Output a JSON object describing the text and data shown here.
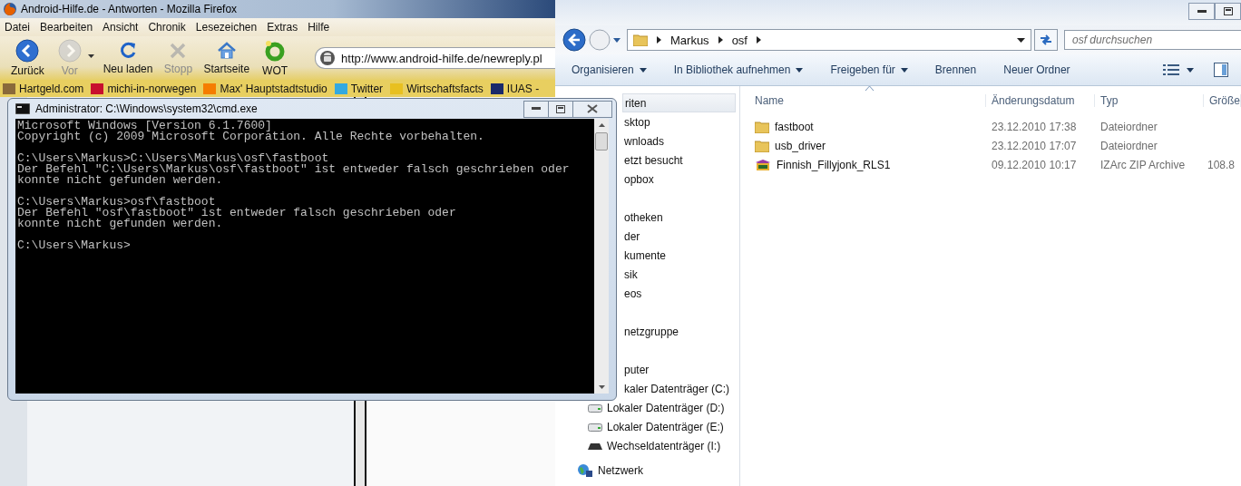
{
  "firefox": {
    "title": "Android-Hilfe.de - Antworten - Mozilla Firefox",
    "menu": [
      "Datei",
      "Bearbeiten",
      "Ansicht",
      "Chronik",
      "Lesezeichen",
      "Extras",
      "Hilfe"
    ],
    "toolbar": [
      {
        "label": "Zurück",
        "kind": "back",
        "disabled": false
      },
      {
        "label": "Vor",
        "kind": "forward",
        "disabled": true
      },
      {
        "label": "Neu laden",
        "kind": "reload",
        "disabled": false
      },
      {
        "label": "Stopp",
        "kind": "stop",
        "disabled": true
      },
      {
        "label": "Startseite",
        "kind": "home",
        "disabled": false
      },
      {
        "label": "WOT",
        "kind": "wot",
        "disabled": false
      }
    ],
    "url": "http://www.android-hilfe.de/newreply.pl",
    "bookmarks": [
      {
        "label": "Hartgeld.com",
        "color": "#8a6a3a"
      },
      {
        "label": "michi-in-norwegen",
        "color": "#c8102e"
      },
      {
        "label": "Max' Hauptstadtstudio",
        "color": "#f57d00"
      },
      {
        "label": "Twitter",
        "color": "#33a9e0"
      },
      {
        "label": "Wirtschaftsfacts",
        "color": "#e8c020"
      },
      {
        "label": "IUAS -",
        "color": "#1a2a6a"
      }
    ]
  },
  "explorer": {
    "breadcrumb": [
      "Markus",
      "osf"
    ],
    "search": {
      "placeholder": "osf durchsuchen"
    },
    "commands": [
      {
        "label": "Organisieren",
        "menu": true
      },
      {
        "label": "In Bibliothek aufnehmen",
        "menu": true
      },
      {
        "label": "Freigeben für",
        "menu": true
      },
      {
        "label": "Brennen",
        "menu": false
      },
      {
        "label": "Neuer Ordner",
        "menu": false
      }
    ],
    "nav_groups": [
      [
        {
          "label": "riten",
          "kind": "cut",
          "selected": true
        },
        {
          "label": "sktop",
          "kind": "cut",
          "selected": false
        },
        {
          "label": "wnloads",
          "kind": "cut",
          "selected": false
        },
        {
          "label": "etzt besucht",
          "kind": "cut",
          "selected": false
        },
        {
          "label": "opbox",
          "kind": "cut",
          "selected": false
        }
      ],
      [
        {
          "label": "otheken",
          "kind": "cut",
          "selected": false
        },
        {
          "label": "der",
          "kind": "cut",
          "selected": false
        },
        {
          "label": "kumente",
          "kind": "cut",
          "selected": false
        },
        {
          "label": "sik",
          "kind": "cut",
          "selected": false
        },
        {
          "label": "eos",
          "kind": "cut",
          "selected": false
        }
      ],
      [
        {
          "label": "netzgruppe",
          "kind": "cut",
          "selected": false
        }
      ],
      [
        {
          "label": "puter",
          "kind": "cut",
          "selected": false
        },
        {
          "label": "kaler Datenträger (C:)",
          "kind": "cut",
          "selected": false
        },
        {
          "label": "Lokaler Datenträger (D:)",
          "kind": "drive",
          "selected": false
        },
        {
          "label": "Lokaler Datenträger (E:)",
          "kind": "drive",
          "selected": false
        },
        {
          "label": "Wechseldatenträger (I:)",
          "kind": "removable",
          "selected": false
        }
      ],
      [
        {
          "label": "Netzwerk",
          "kind": "network",
          "selected": false
        }
      ]
    ],
    "columns": [
      "Name",
      "Änderungsdatum",
      "Typ",
      "Größe"
    ],
    "files": [
      {
        "name": "fastboot",
        "kind": "folder",
        "date": "23.12.2010 17:38",
        "type": "Dateiordner"
      },
      {
        "name": "usb_driver",
        "kind": "folder",
        "date": "23.12.2010 17:07",
        "type": "Dateiordner"
      },
      {
        "name": "Finnish_Fillyjonk_RLS1",
        "kind": "zip",
        "date": "09.12.2010 10:17",
        "type": "IZArc ZIP Archive",
        "size": "108.8"
      }
    ]
  },
  "cmd": {
    "title": "Administrator: C:\\Windows\\system32\\cmd.exe",
    "output": [
      {
        "lines": [
          "Microsoft Windows [Version 6.1.7600]",
          "Copyright (c) 2009 Microsoft Corporation. Alle Rechte vorbehalten."
        ]
      },
      {
        "lines": [
          "C:\\Users\\Markus>C:\\Users\\Markus\\osf\\fastboot",
          "Der Befehl \"C:\\Users\\Markus\\osf\\fastboot\" ist entweder falsch geschrieben oder",
          "konnte nicht gefunden werden."
        ]
      },
      {
        "lines": [
          "C:\\Users\\Markus>osf\\fastboot",
          "Der Befehl \"osf\\fastboot\" ist entweder falsch geschrieben oder",
          "konnte nicht gefunden werden."
        ]
      },
      {
        "lines": [
          "C:\\Users\\Markus>"
        ]
      }
    ]
  }
}
